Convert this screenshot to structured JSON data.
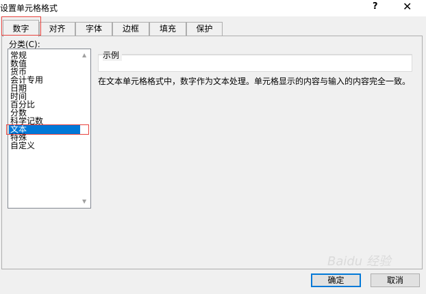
{
  "window": {
    "title": "设置单元格格式",
    "help": "?",
    "close": "✕"
  },
  "tabs": [
    {
      "label": "数字",
      "active": true
    },
    {
      "label": "对齐"
    },
    {
      "label": "字体"
    },
    {
      "label": "边框"
    },
    {
      "label": "填充"
    },
    {
      "label": "保护"
    }
  ],
  "category": {
    "label": "分类(C):",
    "items": [
      "常规",
      "数值",
      "货币",
      "会计专用",
      "日期",
      "时间",
      "百分比",
      "分数",
      "科学记数",
      "文本",
      "特殊",
      "自定义"
    ],
    "selected": "文本"
  },
  "sample": {
    "label": "示例"
  },
  "description": "在文本单元格格式中，数字作为文本处理。单元格显示的内容与输入的内容完全一致。",
  "buttons": {
    "ok": "确定",
    "cancel": "取消"
  },
  "watermark": "Baidu 经验",
  "colors": {
    "highlight": "#e8413c",
    "selection": "#0078d7"
  }
}
